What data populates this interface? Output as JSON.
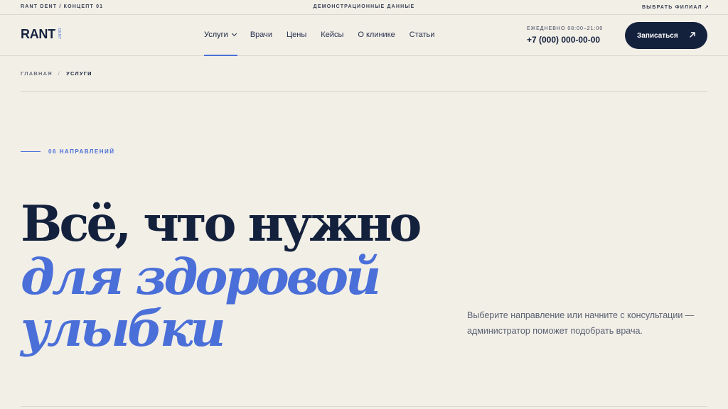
{
  "topbar": {
    "left": "RANT DENT / КОНЦЕПТ 01",
    "center": "ДЕМОНСТРАЦИОННЫЕ ДАННЫЕ",
    "right": "ВЫБРАТЬ ФИЛИАЛ ↗"
  },
  "header": {
    "logo": "RANT",
    "logo_sub": "DENT",
    "nav": [
      {
        "label": "Услуги"
      },
      {
        "label": "Врачи"
      },
      {
        "label": "Цены"
      },
      {
        "label": "Кейсы"
      },
      {
        "label": "О клинике"
      },
      {
        "label": "Статьи"
      }
    ],
    "hours": "ЕЖЕДНЕВНО 08:00–21:00",
    "phone": "+7 (000) 000-00-00",
    "cta": "Записаться"
  },
  "breadcrumb": {
    "home": "ГЛАВНАЯ",
    "separator": "/",
    "current": "УСЛУГИ"
  },
  "kicker": "06 НАПРАВЛЕНИЙ",
  "hero": {
    "line1": "Всё, что нужно",
    "line2": "для здоровой",
    "line3": "улыбки"
  },
  "lead": "Выберите направление или начните с консультации — администратор поможет подобрать врача.",
  "colors": {
    "background": "#f2efe7",
    "navy": "#14213d",
    "accent": "#4a6fd8"
  }
}
